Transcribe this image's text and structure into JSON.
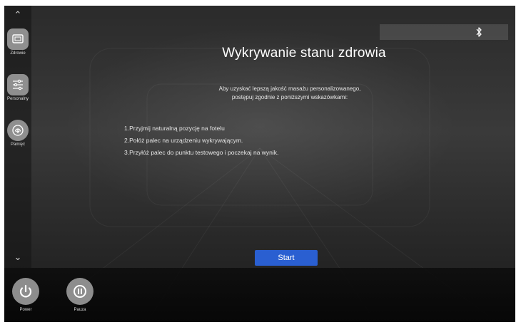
{
  "sidebar": {
    "items": [
      {
        "label": "Zdrowie",
        "icon": "health-screen-icon"
      },
      {
        "label": "Personalny",
        "icon": "sliders-icon"
      },
      {
        "label": "Pamięć",
        "icon": "memory-icon"
      }
    ]
  },
  "main": {
    "title": "Wykrywanie stanu zdrowia",
    "intro_line1": "Aby uzyskać lepszą jakość  masażu personalizowanego,",
    "intro_line2": "postępuj zgodnie z poniższymi wskazówkami:",
    "steps": [
      "1.Przyjmij naturalną pozycję na fotelu",
      "2.Połóż palec na urządzeniu wykrywającym.",
      "3.Przyłóż palec do punktu testowego i poczekaj na wynik."
    ],
    "start_label": "Start"
  },
  "bottom": {
    "power_label": "Power",
    "pause_label": "Pauza"
  },
  "status": {
    "bluetooth_icon": "bluetooth-icon"
  },
  "colors": {
    "accent": "#2a5fd1",
    "icon_gray": "#8f8f8f",
    "background": "#2e2e2e"
  }
}
